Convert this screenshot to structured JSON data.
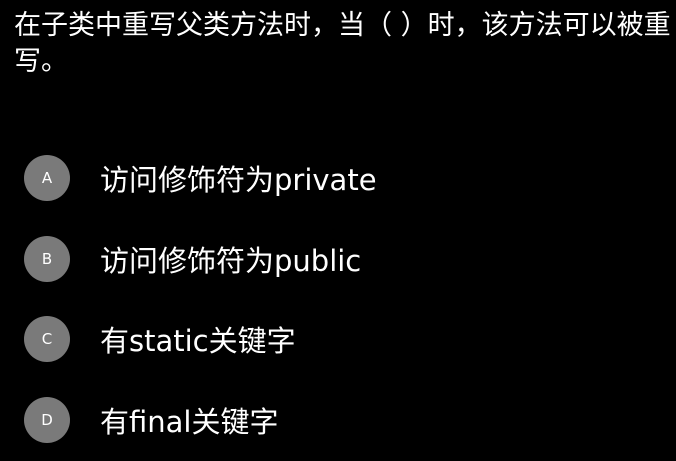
{
  "question": "在子类中重写父类方法时，当（ ）时，该方法可以被重写。",
  "options": [
    {
      "letter": "A",
      "text": "访问修饰符为private"
    },
    {
      "letter": "B",
      "text": "访问修饰符为public"
    },
    {
      "letter": "C",
      "text": "有static关键字"
    },
    {
      "letter": "D",
      "text": "有final关键字"
    }
  ]
}
